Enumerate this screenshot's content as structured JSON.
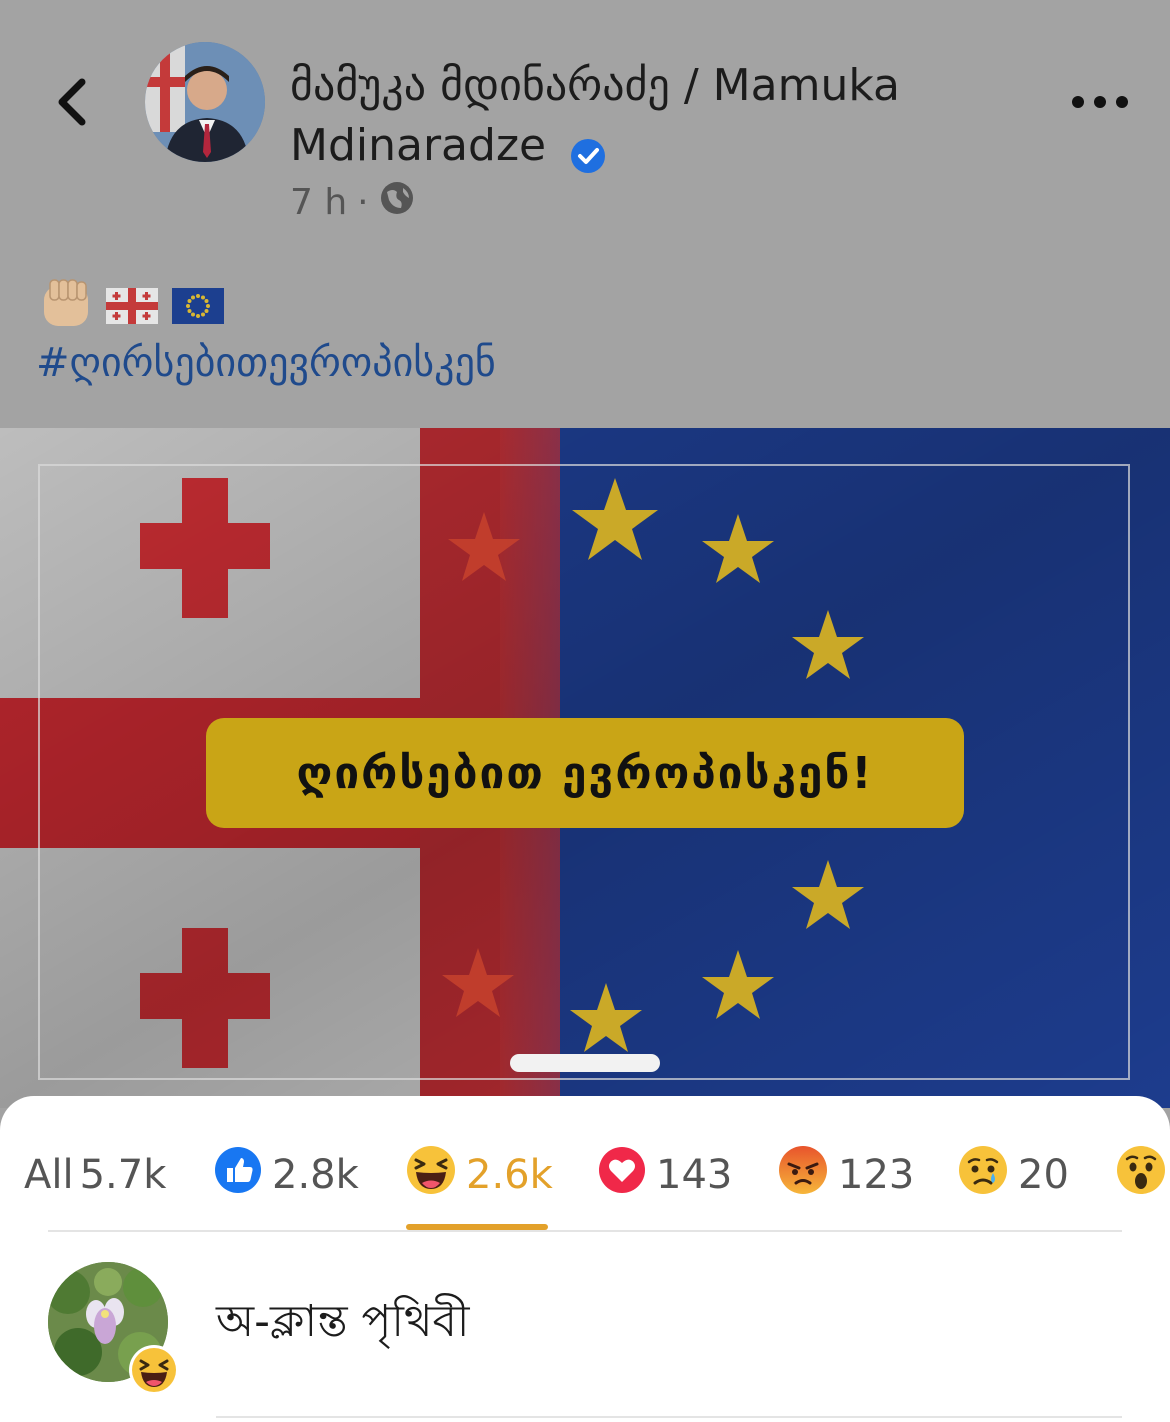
{
  "post": {
    "author_line1": "მამუკა მდინარაძე / Mamuka",
    "author_line2": "Mdinaradze",
    "time": "7 h",
    "separator": "·",
    "hashtag": "#ღირსებითევროპისკენ",
    "image_banner": "ღირსებით ევროპისკენ!"
  },
  "reactions": {
    "all_label": "All",
    "all_count": "5.7k",
    "like": "2.8k",
    "haha": "2.6k",
    "love": "143",
    "angry": "123",
    "sad": "20"
  },
  "person": {
    "name": "অ-ক্লান্ত পৃথিবী"
  },
  "colors": {
    "accent": "#e3a12a",
    "like_blue": "#1877f2",
    "love_red": "#f02849",
    "verified_blue": "#1f6fe0",
    "hashtag": "#1f4a8c"
  }
}
